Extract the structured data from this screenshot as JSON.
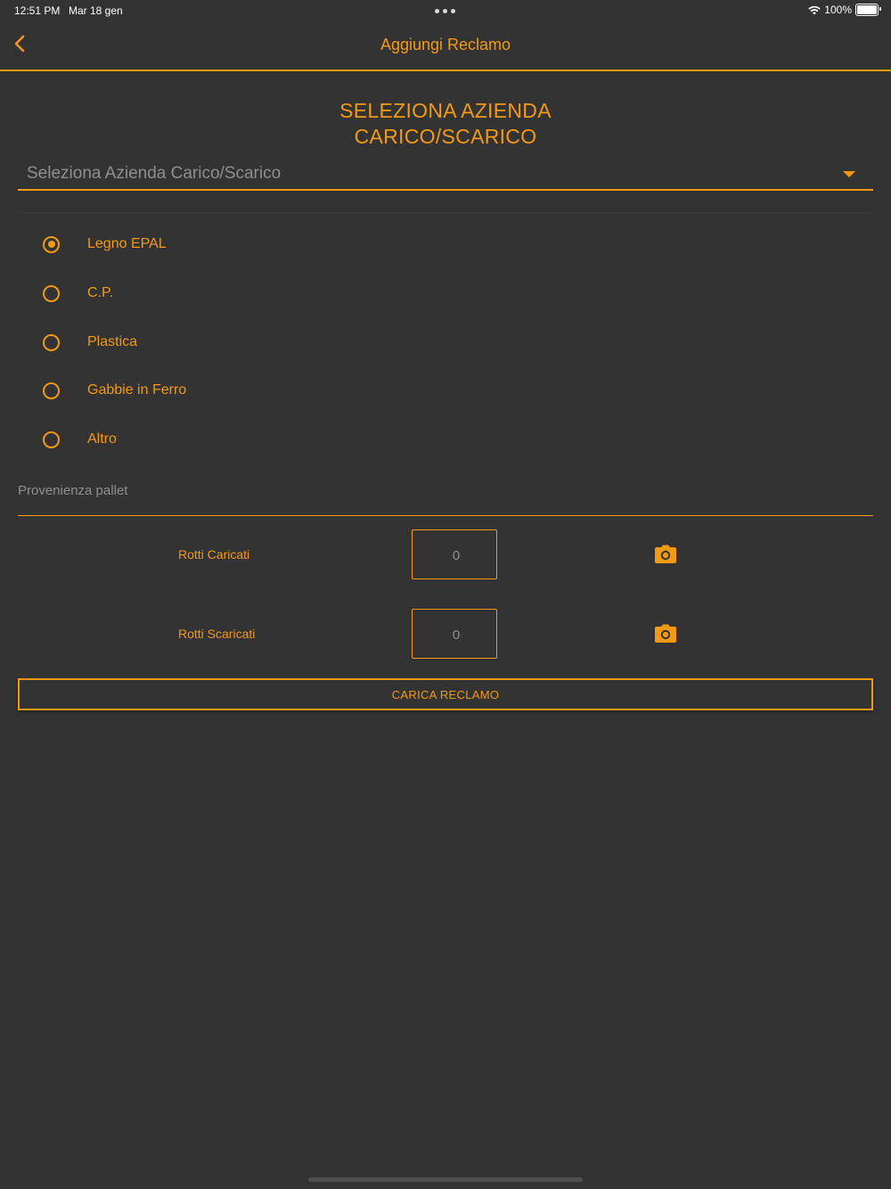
{
  "status_bar": {
    "time": "12:51 PM",
    "date": "Mar 18 gen",
    "battery": "100%"
  },
  "nav": {
    "title": "Aggiungi Reclamo",
    "back_icon": "chevron-left-icon"
  },
  "section": {
    "title_line1": "SELEZIONA AZIENDA",
    "title_line2": "CARICO/SCARICO"
  },
  "company_select": {
    "placeholder": "Seleziona Azienda Carico/Scarico",
    "icon": "caret-down-icon"
  },
  "pallet_types": [
    {
      "label": "Legno EPAL",
      "checked": true
    },
    {
      "label": "C.P.",
      "checked": false
    },
    {
      "label": "Plastica",
      "checked": false
    },
    {
      "label": "Gabbie in Ferro",
      "checked": false
    },
    {
      "label": "Altro",
      "checked": false
    }
  ],
  "origin": {
    "placeholder": "Provenienza pallet"
  },
  "rows": [
    {
      "label": "Rotti Caricati",
      "placeholder": "0",
      "icon": "camera-icon"
    },
    {
      "label": "Rotti Scaricati",
      "placeholder": "0",
      "icon": "camera-icon"
    }
  ],
  "submit_label": "CARICA RECLAMO",
  "colors": {
    "accent": "#f39a11",
    "background": "#333333",
    "placeholder": "#8f8f8f"
  }
}
